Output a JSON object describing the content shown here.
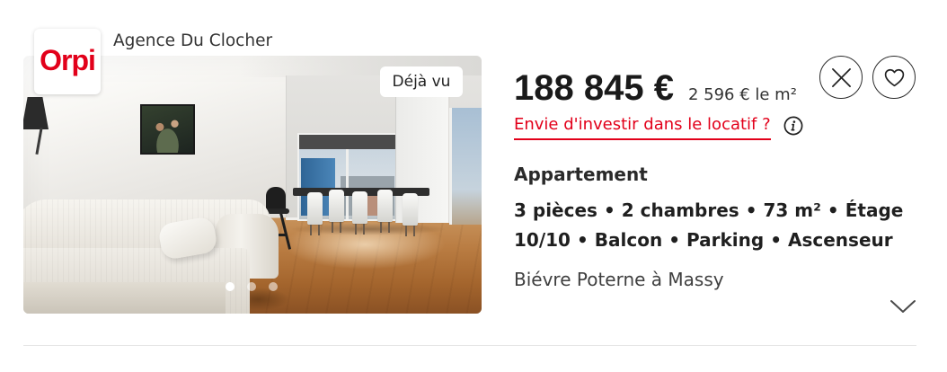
{
  "agency": {
    "name": "Agence Du Clocher",
    "logo_text": "Orpi"
  },
  "photo": {
    "badge": "Déjà vu",
    "slides": 3,
    "active_slide": 1
  },
  "listing": {
    "price": "188 845 €",
    "price_per_m2": "2 596 € le m²",
    "invest_link": "Envie d'investir dans le locatif ?",
    "property_type": "Appartement",
    "features": [
      "3 pièces",
      "2 chambres",
      "73 m²",
      "Étage 10/10",
      "Balcon",
      "Parking",
      "Ascenseur"
    ],
    "location": "Biévre Poterne à Massy"
  },
  "icons": {
    "info": "info-icon",
    "dismiss": "close-icon",
    "favorite": "heart-icon",
    "expand": "chevron-down-icon"
  },
  "colors": {
    "brand_red": "#e2001a",
    "text": "#1f1f1f",
    "divider": "#e6e6e6"
  }
}
